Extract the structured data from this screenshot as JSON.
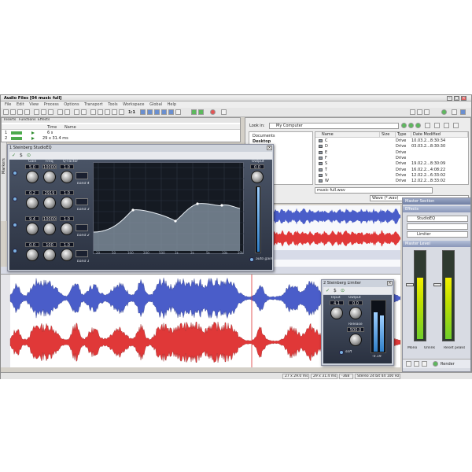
{
  "window": {
    "title": "Audio Files [04 music full]"
  },
  "menu": [
    "File",
    "Edit",
    "View",
    "Process",
    "Options",
    "Transport",
    "Tools",
    "Workspace",
    "Global",
    "Help"
  ],
  "toolbar": {
    "zoom_ratio": "1:1"
  },
  "file_list": {
    "tabs": [
      "Inserts",
      "Functions",
      "Effects"
    ],
    "columns": [
      "Time",
      "Name"
    ],
    "rows": [
      {
        "index": "1",
        "time": "6 s",
        "name": ""
      },
      {
        "index": "2",
        "time": "29 x 31.4 ms",
        "name": ""
      }
    ]
  },
  "browser": {
    "look_in_label": "Look in:",
    "look_in_value": "My Computer",
    "tree": [
      "Documents",
      "Desktop"
    ],
    "columns": [
      "Name",
      "Size",
      "Type",
      "Date Modified"
    ],
    "rows": [
      {
        "name": "C",
        "type": "Drive",
        "date": "10.03.2...8:30:34"
      },
      {
        "name": "D",
        "type": "Drive",
        "date": "03.03.2...8:30:30"
      },
      {
        "name": "E",
        "type": "Drive",
        "date": ""
      },
      {
        "name": "F",
        "type": "Drive",
        "date": ""
      },
      {
        "name": "S",
        "type": "Drive",
        "date": "19.02.2...8:30:09"
      },
      {
        "name": "T",
        "type": "Drive",
        "date": "16.02.2...4:08:22"
      },
      {
        "name": "V",
        "type": "Drive",
        "date": "12.02.2...6:33:02"
      },
      {
        "name": "W",
        "type": "Drive",
        "date": "12.02.2...8:33:02"
      }
    ],
    "filename": "music full.wav",
    "filetype": "Wave (*.wav)"
  },
  "markers_label": "Markers",
  "eq": {
    "title": "1 Steinberg StudioEQ",
    "columns": [
      "Gain",
      "Freq",
      "Q-Factor"
    ],
    "bands": [
      {
        "gain": "5.0",
        "freq": "10000",
        "q": "1.0",
        "label": "band 4"
      },
      {
        "gain": "0.2",
        "freq": "2919",
        "q": "1.0",
        "label": "band 3"
      },
      {
        "gain": "9.4",
        "freq": "10000",
        "q": "1.0",
        "label": "band 2"
      },
      {
        "gain": "0.0",
        "freq": "100",
        "q": "1.0",
        "label": "band 1"
      }
    ],
    "output_label": "Output",
    "output_value": "0.0",
    "auto_gain": "auto gain",
    "grid_x": [
      "20",
      "50",
      "100",
      "200",
      "500",
      "1k",
      "2k",
      "5k",
      "10k",
      "20k"
    ]
  },
  "limiter": {
    "title": "2 Steinberg Limiter",
    "input_label": "Input",
    "input_value": "4.1",
    "output_label": "Output",
    "output_value": "0.0",
    "release_label": "Release",
    "release_value": "500.0",
    "soft_label": "soft",
    "meter_readout": "-0.19"
  },
  "master": {
    "title": "Master Section",
    "effects_label": "Effects",
    "slots": [
      "StudioEQ",
      "",
      "Limiter"
    ],
    "level_label": "Master Level",
    "buttons": [
      "Mono",
      "Unlink",
      "Reset peaks"
    ],
    "render_label": "Render"
  },
  "status": {
    "items": [
      "27 x 29.0 ms",
      "29 x 31.4 ms",
      "-368",
      "Stereo 24 bit 44 100 Hz"
    ]
  },
  "colors": {
    "wave_left": "#4a5dc9",
    "wave_right": "#e03838",
    "accent": "#7bb1e0"
  }
}
